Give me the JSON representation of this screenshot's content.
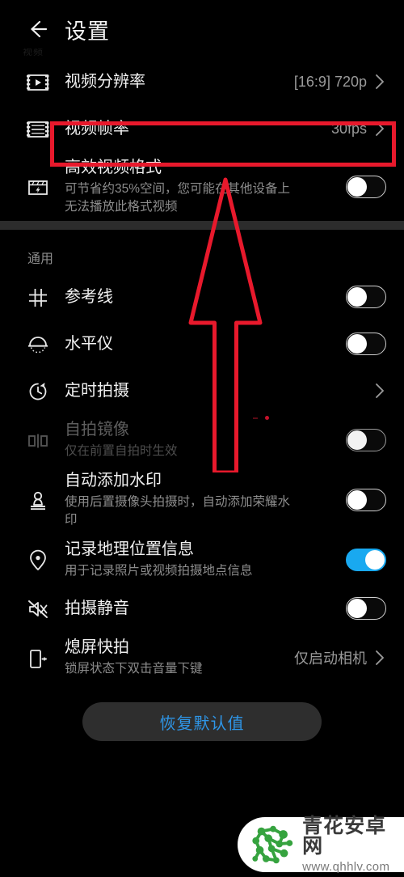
{
  "header": {
    "back_icon": "back-arrow-icon",
    "title": "设置",
    "ghost_label": "视频"
  },
  "video_section": {
    "rows": [
      {
        "icon": "video-resolution-icon",
        "label": "视频分辨率",
        "value": "[16:9] 720p",
        "control": "chevron"
      },
      {
        "icon": "video-framerate-icon",
        "label": "视频帧率",
        "value": "30fps",
        "control": "chevron",
        "highlighted": true
      },
      {
        "icon": "efficient-video-format-icon",
        "label": "高效视频格式",
        "sub": "可节省约35%空间，您可能在其他设备上无法播放此格式视频",
        "control": "toggle",
        "toggle_on": false
      }
    ]
  },
  "general_section": {
    "title": "通用",
    "rows": [
      {
        "icon": "grid-lines-icon",
        "label": "参考线",
        "control": "toggle",
        "toggle_on": false
      },
      {
        "icon": "level-meter-icon",
        "label": "水平仪",
        "control": "toggle",
        "toggle_on": false
      },
      {
        "icon": "timer-icon",
        "label": "定时拍摄",
        "control": "chevron"
      },
      {
        "icon": "mirror-selfie-icon",
        "label": "自拍镜像",
        "sub": "仅在前置自拍时生效",
        "control": "toggle",
        "toggle_on": false,
        "disabled": true
      },
      {
        "icon": "watermark-stamp-icon",
        "label": "自动添加水印",
        "sub": "使用后置摄像头拍摄时，自动添加荣耀水印",
        "control": "toggle",
        "toggle_on": false
      },
      {
        "icon": "location-pin-icon",
        "label": "记录地理位置信息",
        "sub": "用于记录照片或视频拍摄地点信息",
        "control": "toggle",
        "toggle_on": true
      },
      {
        "icon": "mute-shutter-icon",
        "label": "拍摄静音",
        "control": "toggle",
        "toggle_on": false
      },
      {
        "icon": "screen-off-quick-capture-icon",
        "label": "熄屏快拍",
        "sub": "锁屏状态下双击音量下键",
        "value": "仅启动相机",
        "control": "chevron"
      }
    ]
  },
  "footer": {
    "reset_label": "恢复默认值"
  },
  "annotations": {
    "highlight_color": "#e8192c",
    "arrow_color": "#e8192c",
    "arrow_name": "red-up-arrow"
  },
  "watermark": {
    "site_name": "青花安卓网",
    "url": "www.qhhlv.com",
    "logo": "green-network-logo"
  },
  "colors": {
    "background": "#000000",
    "toggle_on": "#19a9f0",
    "accent_text": "#2e96e8",
    "band": "#2c2c2c"
  }
}
